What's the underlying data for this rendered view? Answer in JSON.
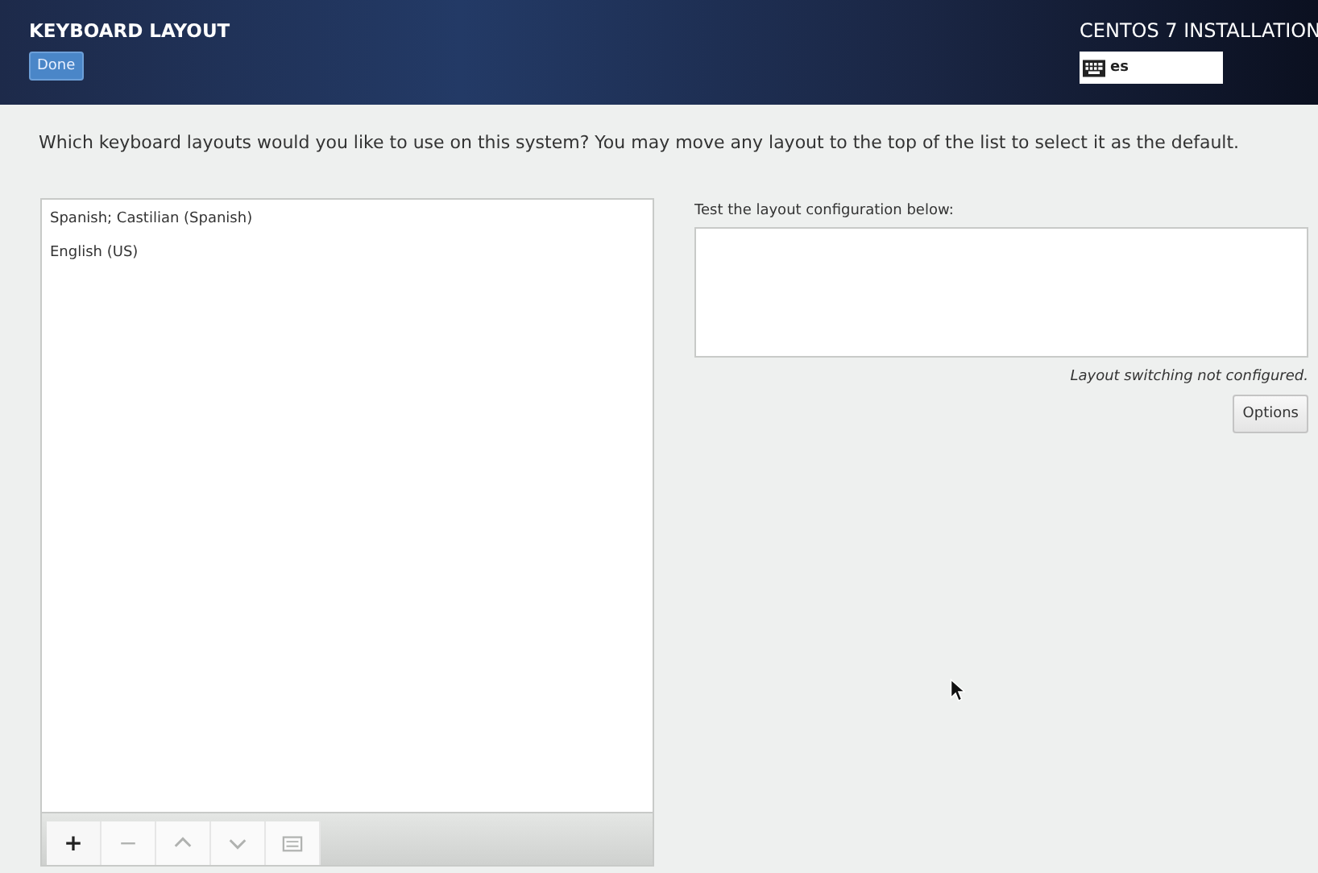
{
  "header": {
    "title": "KEYBOARD LAYOUT",
    "done_button": "Done",
    "product": "CENTOS 7 INSTALLATION",
    "layout_indicator": "es"
  },
  "prompt": "Which keyboard layouts would you like to use on this system?  You may move any layout to the top of the list to select it as the default.",
  "layouts": [
    {
      "label": "Spanish; Castilian (Spanish)",
      "selected": false
    },
    {
      "label": "English (US)",
      "selected": false
    }
  ],
  "toolbar": [
    {
      "kind": "text",
      "label": "+",
      "disabled": false
    },
    {
      "kind": "text",
      "label": "−",
      "disabled": true
    },
    {
      "kind": "up",
      "disabled": true
    },
    {
      "kind": "down",
      "disabled": true
    },
    {
      "kind": "keyboard",
      "disabled": true
    }
  ],
  "test": {
    "label": "Test the layout configuration below:",
    "note": "Layout switching not configured.",
    "options_button": "Options"
  }
}
